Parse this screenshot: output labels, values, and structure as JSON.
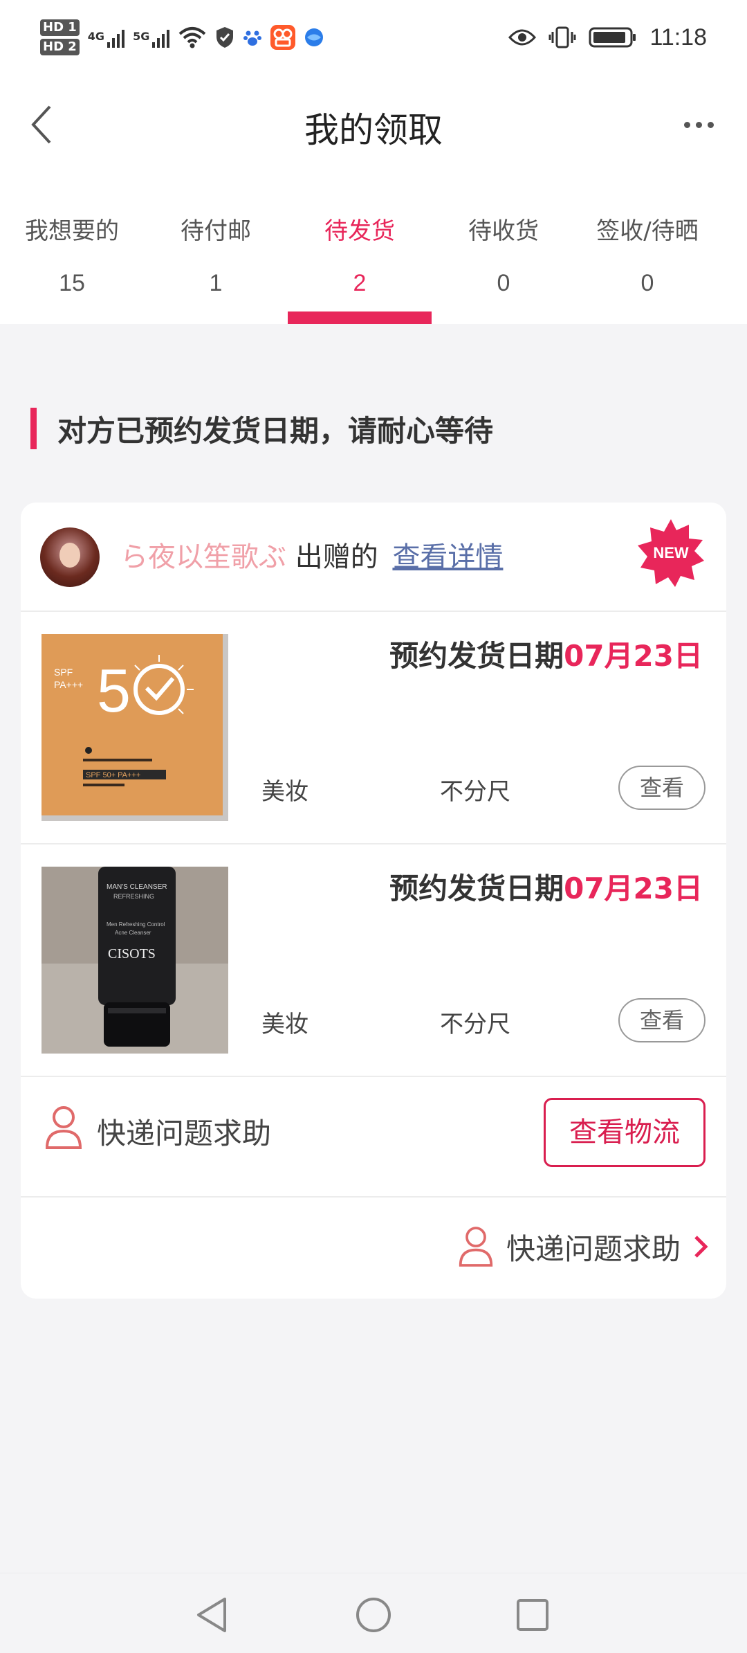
{
  "status_bar": {
    "hd1": "HD 1",
    "hd2": "HD 2",
    "net1": "4G",
    "net2": "5G",
    "time": "11:18"
  },
  "header": {
    "title": "我的领取"
  },
  "tabs": [
    {
      "label": "我想要的",
      "count": "15"
    },
    {
      "label": "待付邮",
      "count": "1"
    },
    {
      "label": "待发货",
      "count": "2"
    },
    {
      "label": "待收货",
      "count": "0"
    },
    {
      "label": "签收/待晒",
      "count": "0"
    }
  ],
  "active_tab_index": 2,
  "notice": "对方已预约发货日期，请耐心等待",
  "order": {
    "giver_name": "ら夜以笙歌ぶ",
    "giver_suffix": " 出赠的",
    "detail_link": "查看详情",
    "new_badge": "NEW",
    "items": [
      {
        "date_prefix": "预约发货日期",
        "date": "07月23日",
        "category": "美妆",
        "size": "不分尺",
        "view_label": "查看",
        "image": "sunscreen-box"
      },
      {
        "date_prefix": "预约发货日期",
        "date": "07月23日",
        "category": "美妆",
        "size": "不分尺",
        "view_label": "查看",
        "image": "cleanser-tube"
      }
    ],
    "help_label": "快递问题求助",
    "logistics_button": "查看物流",
    "footer_help_label": "快递问题求助"
  },
  "colors": {
    "accent": "#e8265a",
    "giver_name": "#f0a0a8",
    "link": "#5a6fa8"
  }
}
